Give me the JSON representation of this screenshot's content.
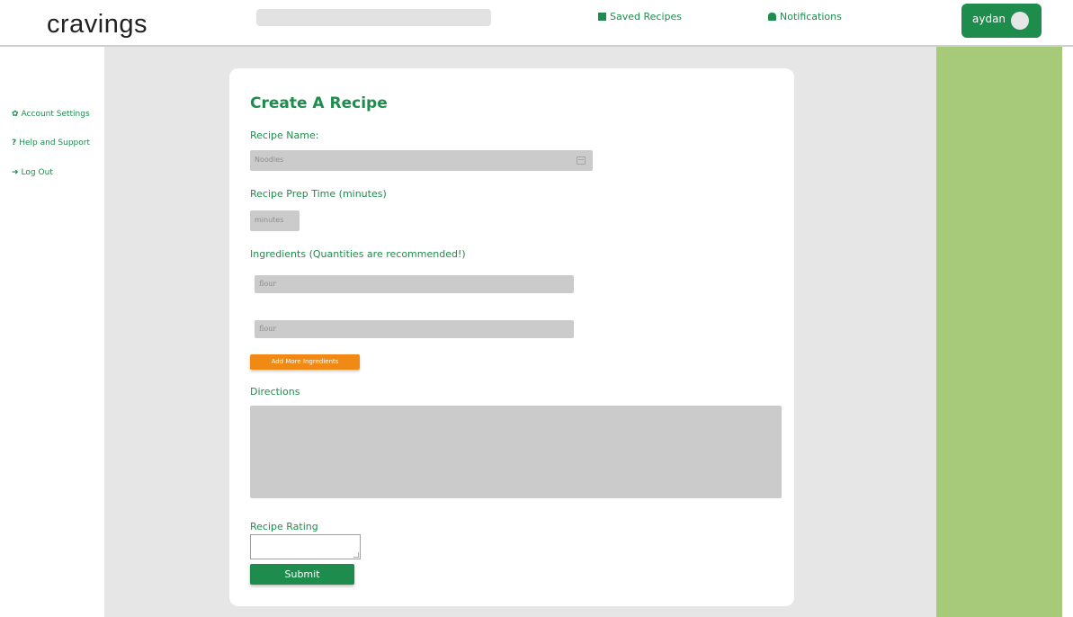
{
  "app": {
    "logo": "cravings"
  },
  "header": {
    "search_value": "",
    "saved_recipes": "Saved Recipes",
    "notifications": "Notifications",
    "user_name": "aydan"
  },
  "sidebar": {
    "items": [
      {
        "label": "Account Settings",
        "icon": "gear-icon"
      },
      {
        "label": "Help and Support",
        "icon": "question-icon"
      },
      {
        "label": "Log Out",
        "icon": "logout-icon"
      }
    ]
  },
  "form": {
    "title": "Create A Recipe",
    "name_label": "Recipe Name:",
    "name_value": "Noodles",
    "prep_label": "Recipe Prep Time (minutes)",
    "prep_placeholder": "minutes",
    "ingredients_label": "Ingredients (Quantities are recommended!)",
    "ingredients": [
      "flour",
      "flour"
    ],
    "add_button": "Add More Ingredients",
    "directions_label": "Directions",
    "directions_value": "",
    "rating_label": "Recipe Rating",
    "rating_value": "",
    "submit_label": "Submit"
  },
  "colors": {
    "brand_green": "#1e8c4d",
    "accent_orange": "#f08a14",
    "panel_green": "#a7c97a",
    "background_grey": "#e6e6e6"
  }
}
